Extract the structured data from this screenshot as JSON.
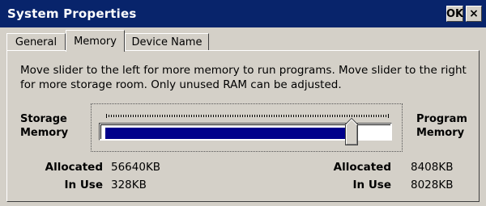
{
  "window": {
    "title": "System Properties",
    "ok_label": "OK",
    "close_label": "×"
  },
  "tabs": [
    {
      "label": "General",
      "active": false
    },
    {
      "label": "Memory",
      "active": true
    },
    {
      "label": "Device Name",
      "active": false
    }
  ],
  "memory": {
    "description": "Move slider to the left for more memory to run programs. Move slider to the right for more storage room. Only unused RAM can be adjusted.",
    "storage_label_line1": "Storage",
    "storage_label_line2": "Memory",
    "program_label_line1": "Program",
    "program_label_line2": "Memory",
    "slider_position": 0.87,
    "fill_color": "#00008b",
    "storage": {
      "allocated_label": "Allocated",
      "allocated_value": "56640KB",
      "inuse_label": "In Use",
      "inuse_value": "328KB"
    },
    "program": {
      "allocated_label": "Allocated",
      "allocated_value": "8408KB",
      "inuse_label": "In Use",
      "inuse_value": "8028KB"
    }
  },
  "colors": {
    "titlebar": "#08246b",
    "face": "#d4d0c8"
  },
  "icons": {
    "close": "close-icon"
  }
}
